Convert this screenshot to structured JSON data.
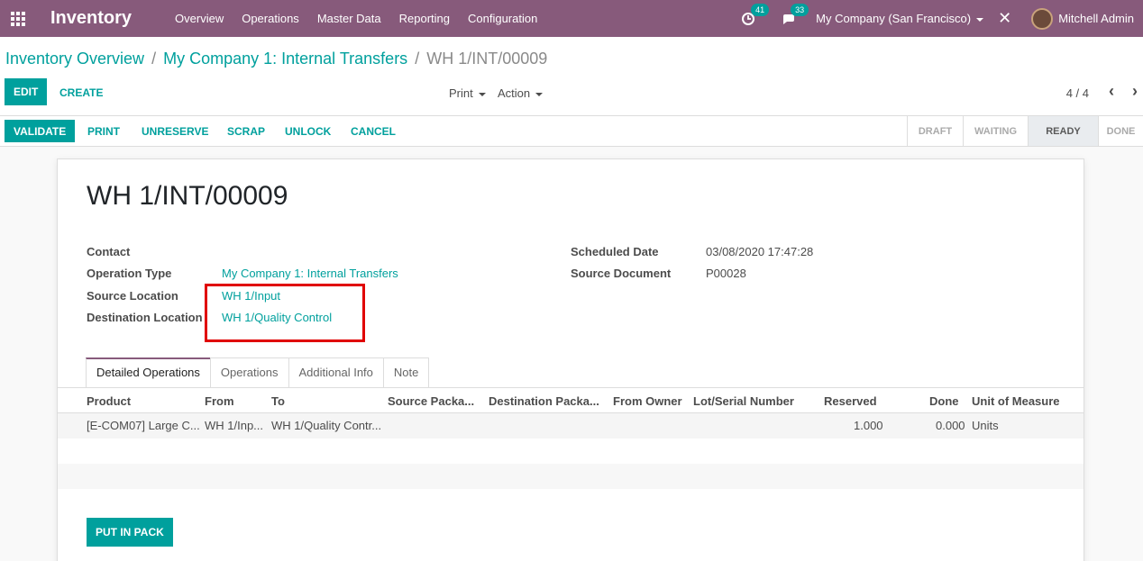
{
  "navbar": {
    "app_name": "Inventory",
    "menu": [
      "Overview",
      "Operations",
      "Master Data",
      "Reporting",
      "Configuration"
    ],
    "activity_count": "41",
    "message_count": "33",
    "company": "My Company (San Francisco)",
    "user": "Mitchell Admin"
  },
  "breadcrumb": {
    "items": [
      "Inventory Overview",
      "My Company 1: Internal Transfers",
      "WH 1/INT/00009"
    ],
    "separator": "/"
  },
  "control_panel": {
    "edit": "EDIT",
    "create": "CREATE",
    "print": "Print",
    "action": "Action",
    "pager": "4 / 4"
  },
  "statusbar": {
    "buttons": [
      "VALIDATE",
      "PRINT",
      "UNRESERVE",
      "SCRAP",
      "UNLOCK",
      "CANCEL"
    ],
    "stages": [
      "DRAFT",
      "WAITING",
      "READY",
      "DONE"
    ],
    "current_stage": "READY"
  },
  "record": {
    "title": "WH 1/INT/00009",
    "fields_left": [
      {
        "label": "Contact",
        "value": ""
      },
      {
        "label": "Operation Type",
        "value": "My Company 1: Internal Transfers"
      },
      {
        "label": "Source Location",
        "value": "WH 1/Input"
      },
      {
        "label": "Destination Location",
        "value": "WH 1/Quality Control"
      }
    ],
    "fields_right": [
      {
        "label": "Scheduled Date",
        "value": "03/08/2020 17:47:28"
      },
      {
        "label": "Source Document",
        "value": "P00028"
      }
    ]
  },
  "tabs": [
    "Detailed Operations",
    "Operations",
    "Additional Info",
    "Note"
  ],
  "table": {
    "columns": [
      "Product",
      "From",
      "To",
      "Source Packa...",
      "Destination Packa...",
      "From Owner",
      "Lot/Serial Number",
      "Reserved",
      "Done",
      "Unit of Measure"
    ],
    "rows": [
      {
        "product": "[E-COM07] Large C...",
        "from": "WH 1/Inp...",
        "to": "WH 1/Quality Contr...",
        "reserved": "1.000",
        "done": "0.000",
        "uom": "Units"
      }
    ]
  },
  "put_in_pack": "PUT IN PACK",
  "colors": {
    "brand": "#875a7b",
    "accent": "#00a09d",
    "highlight": "#e00000"
  }
}
